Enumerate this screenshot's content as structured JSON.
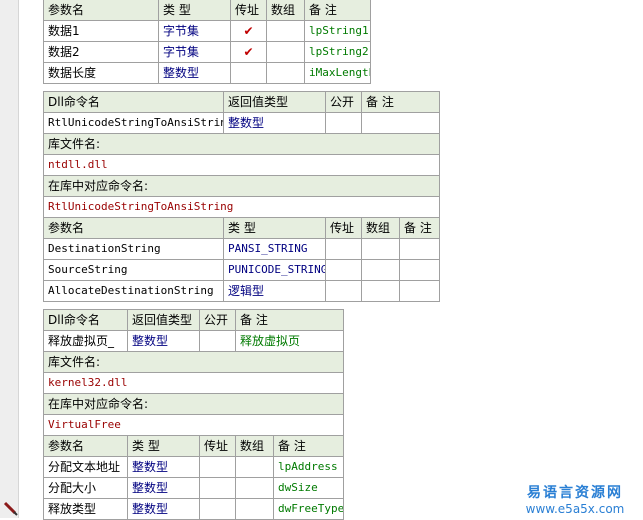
{
  "params_table": {
    "headers": [
      "参数名",
      "类 型",
      "传址",
      "数组",
      "备 注"
    ],
    "rows": [
      {
        "name": "数据1",
        "type": "字节集",
        "byref": "✔",
        "array": "",
        "note": "lpString1"
      },
      {
        "name": "数据2",
        "type": "字节集",
        "byref": "✔",
        "array": "",
        "note": "lpString2"
      },
      {
        "name": "数据长度",
        "type": "整数型",
        "byref": "",
        "array": "",
        "note": "iMaxLength"
      }
    ]
  },
  "dll1": {
    "headers": [
      "Dll命令名",
      "返回值类型",
      "公开",
      "备 注"
    ],
    "name": "RtlUnicodeStringToAnsiString",
    "return_type": "整数型",
    "public": "",
    "note": "",
    "lib_label": "库文件名:",
    "lib": "ntdll.dll",
    "entry_label": "在库中对应命令名:",
    "entry": "RtlUnicodeStringToAnsiString",
    "param_headers": [
      "参数名",
      "类 型",
      "传址",
      "数组",
      "备 注"
    ],
    "params": [
      {
        "name": "DestinationString",
        "type": "PANSI_STRING",
        "byref": "",
        "array": "",
        "note": ""
      },
      {
        "name": "SourceString",
        "type": "PUNICODE_STRING",
        "byref": "",
        "array": "",
        "note": ""
      },
      {
        "name": "AllocateDestinationString",
        "type": "逻辑型",
        "byref": "",
        "array": "",
        "note": ""
      }
    ]
  },
  "dll2": {
    "headers": [
      "Dll命令名",
      "返回值类型",
      "公开",
      "备 注"
    ],
    "name": "释放虚拟页_",
    "return_type": "整数型",
    "public": "",
    "note": "释放虚拟页",
    "lib_label": "库文件名:",
    "lib": "kernel32.dll",
    "entry_label": "在库中对应命令名:",
    "entry": "VirtualFree",
    "param_headers": [
      "参数名",
      "类 型",
      "传址",
      "数组",
      "备 注"
    ],
    "params": [
      {
        "name": "分配文本地址",
        "type": "整数型",
        "byref": "",
        "array": "",
        "note": "lpAddress"
      },
      {
        "name": "分配大小",
        "type": "整数型",
        "byref": "",
        "array": "",
        "note": "dwSize"
      },
      {
        "name": "释放类型",
        "type": "整数型",
        "byref": "",
        "array": "",
        "note": "dwFreeType"
      }
    ]
  },
  "watermark": {
    "cn": "易语言资源网",
    "url": "www.e5a5x.com"
  },
  "colors": {
    "header_bg": "#e6eedf",
    "border": "#a0a0a0",
    "type_blue": "#000080",
    "lib_red": "#990000",
    "note_green": "#007a00"
  }
}
